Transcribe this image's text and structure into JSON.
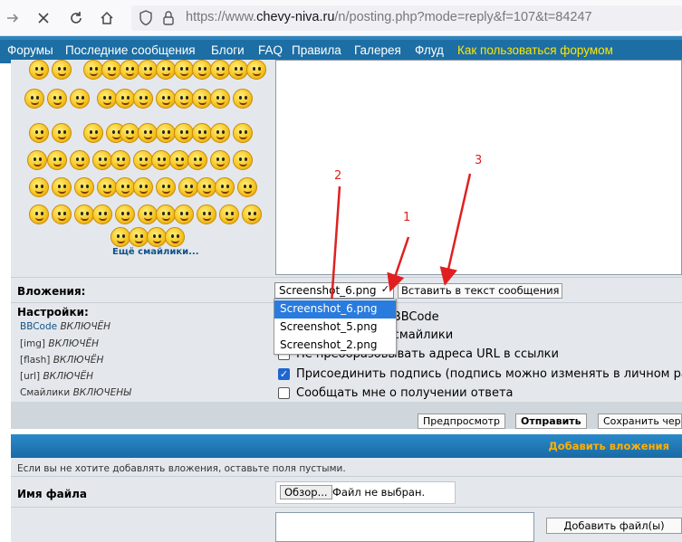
{
  "browser": {
    "url_prefix": "https://www.",
    "url_domain": "chevy-niva.ru",
    "url_path": "/n/posting.php?mode=reply&f=107&t=84247"
  },
  "nav": {
    "items": [
      "Форумы",
      "Последние сообщения",
      "Блоги",
      "FAQ",
      "Правила",
      "Галерея",
      "Флуд"
    ],
    "highlight": "Как пользоваться форумом"
  },
  "smilies": {
    "more_link": "Ещё смайлики..."
  },
  "attachments": {
    "label": "Вложения:",
    "selected_file": "Screenshot_6.png",
    "insert_button": "Вставить в текст сообщения",
    "options": [
      "Screenshot_6.png",
      "Screenshot_5.png",
      "Screenshot_2.png"
    ]
  },
  "settings": {
    "label": "Настройки:",
    "bbcode_name": "BBCode",
    "bbcode_state": "ВКЛЮЧЁН",
    "img_name": "[img]",
    "img_state": "ВКЛЮЧЁН",
    "flash_name": "[flash]",
    "flash_state": "ВКЛЮЧЁН",
    "url_name": "[url]",
    "url_state": "ВКЛЮЧЁН",
    "smilies_name": "Смайлики",
    "smilies_state": "ВКЛЮЧЕНЫ"
  },
  "checkboxes": [
    {
      "label": "м сообщении BBCode",
      "checked": false
    },
    {
      "label": "м сообщении смайлики",
      "checked": false
    },
    {
      "label": "Не преобразовывать адреса URL в ссылки",
      "checked": false
    },
    {
      "label": "Присоединить подпись (подпись можно изменять в личном разде",
      "checked": true
    },
    {
      "label": "Сообщать мне о получении ответа",
      "checked": false
    }
  ],
  "buttons": {
    "preview": "Предпросмотр",
    "submit": "Отправить",
    "save": "Сохранить черн"
  },
  "add_attachments": {
    "title": "Добавить вложения",
    "note": "Если вы не хотите добавлять вложения, оставьте поля пустыми.",
    "filename_label": "Имя файла",
    "browse": "Обзор...",
    "no_file": "Файл не выбран.",
    "add_file": "Добавить файл(ы)"
  },
  "annotations": [
    "1",
    "2",
    "3"
  ],
  "colors": {
    "nav_bg": "#1c6ea4",
    "highlight": "#ffe600",
    "annotation": "#e02020",
    "panel_title": "#ffb000"
  }
}
